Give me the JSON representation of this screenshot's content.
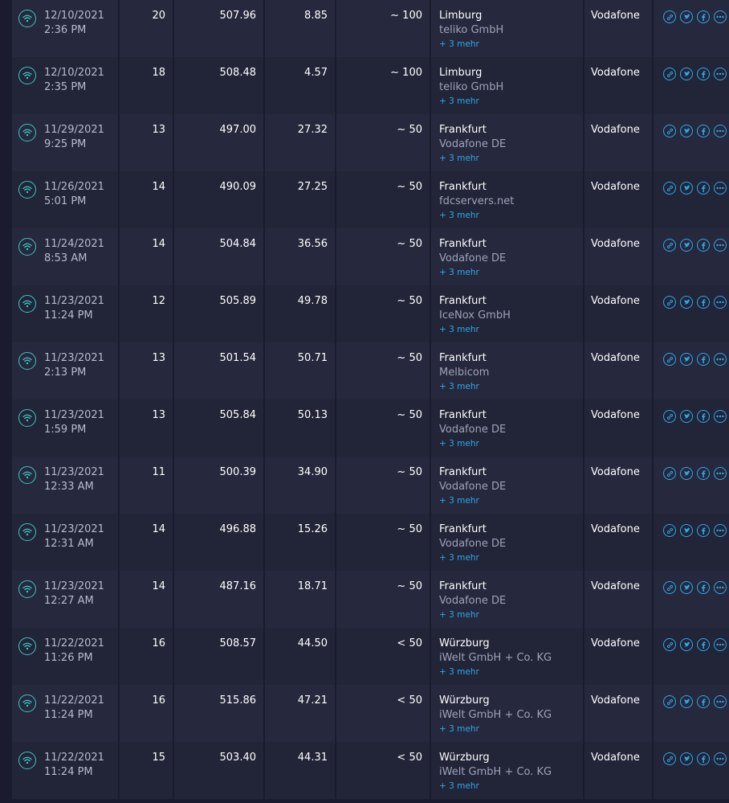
{
  "colors": {
    "accent": "#2fa8e8",
    "connection": "#3ec6c2"
  },
  "more_label": "+ 3 mehr",
  "rows": [
    {
      "date": "12/10/2021",
      "time": "2:36 PM",
      "ping": "20",
      "download": "507.96",
      "upload": "8.85",
      "distance": "~ 100",
      "city": "Limburg",
      "sponsor": "teliko GmbH",
      "isp": "Vodafone"
    },
    {
      "date": "12/10/2021",
      "time": "2:35 PM",
      "ping": "18",
      "download": "508.48",
      "upload": "4.57",
      "distance": "~ 100",
      "city": "Limburg",
      "sponsor": "teliko GmbH",
      "isp": "Vodafone"
    },
    {
      "date": "11/29/2021",
      "time": "9:25 PM",
      "ping": "13",
      "download": "497.00",
      "upload": "27.32",
      "distance": "~ 50",
      "city": "Frankfurt",
      "sponsor": "Vodafone DE",
      "isp": "Vodafone"
    },
    {
      "date": "11/26/2021",
      "time": "5:01 PM",
      "ping": "14",
      "download": "490.09",
      "upload": "27.25",
      "distance": "~ 50",
      "city": "Frankfurt",
      "sponsor": "fdcservers.net",
      "isp": "Vodafone"
    },
    {
      "date": "11/24/2021",
      "time": "8:53 AM",
      "ping": "14",
      "download": "504.84",
      "upload": "36.56",
      "distance": "~ 50",
      "city": "Frankfurt",
      "sponsor": "Vodafone DE",
      "isp": "Vodafone"
    },
    {
      "date": "11/23/2021",
      "time": "11:24 PM",
      "ping": "12",
      "download": "505.89",
      "upload": "49.78",
      "distance": "~ 50",
      "city": "Frankfurt",
      "sponsor": "IceNox GmbH",
      "isp": "Vodafone"
    },
    {
      "date": "11/23/2021",
      "time": "2:13 PM",
      "ping": "13",
      "download": "501.54",
      "upload": "50.71",
      "distance": "~ 50",
      "city": "Frankfurt",
      "sponsor": "Melbicom",
      "isp": "Vodafone"
    },
    {
      "date": "11/23/2021",
      "time": "1:59 PM",
      "ping": "13",
      "download": "505.84",
      "upload": "50.13",
      "distance": "~ 50",
      "city": "Frankfurt",
      "sponsor": "Vodafone DE",
      "isp": "Vodafone"
    },
    {
      "date": "11/23/2021",
      "time": "12:33 AM",
      "ping": "11",
      "download": "500.39",
      "upload": "34.90",
      "distance": "~ 50",
      "city": "Frankfurt",
      "sponsor": "Vodafone DE",
      "isp": "Vodafone"
    },
    {
      "date": "11/23/2021",
      "time": "12:31 AM",
      "ping": "14",
      "download": "496.88",
      "upload": "15.26",
      "distance": "~ 50",
      "city": "Frankfurt",
      "sponsor": "Vodafone DE",
      "isp": "Vodafone"
    },
    {
      "date": "11/23/2021",
      "time": "12:27 AM",
      "ping": "14",
      "download": "487.16",
      "upload": "18.71",
      "distance": "~ 50",
      "city": "Frankfurt",
      "sponsor": "Vodafone DE",
      "isp": "Vodafone"
    },
    {
      "date": "11/22/2021",
      "time": "11:26 PM",
      "ping": "16",
      "download": "508.57",
      "upload": "44.50",
      "distance": "< 50",
      "city": "Würzburg",
      "sponsor": "iWelt GmbH + Co. KG",
      "isp": "Vodafone"
    },
    {
      "date": "11/22/2021",
      "time": "11:24 PM",
      "ping": "16",
      "download": "515.86",
      "upload": "47.21",
      "distance": "< 50",
      "city": "Würzburg",
      "sponsor": "iWelt GmbH + Co. KG",
      "isp": "Vodafone"
    },
    {
      "date": "11/22/2021",
      "time": "11:24 PM",
      "ping": "15",
      "download": "503.40",
      "upload": "44.31",
      "distance": "< 50",
      "city": "Würzburg",
      "sponsor": "iWelt GmbH + Co. KG",
      "isp": "Vodafone"
    }
  ]
}
